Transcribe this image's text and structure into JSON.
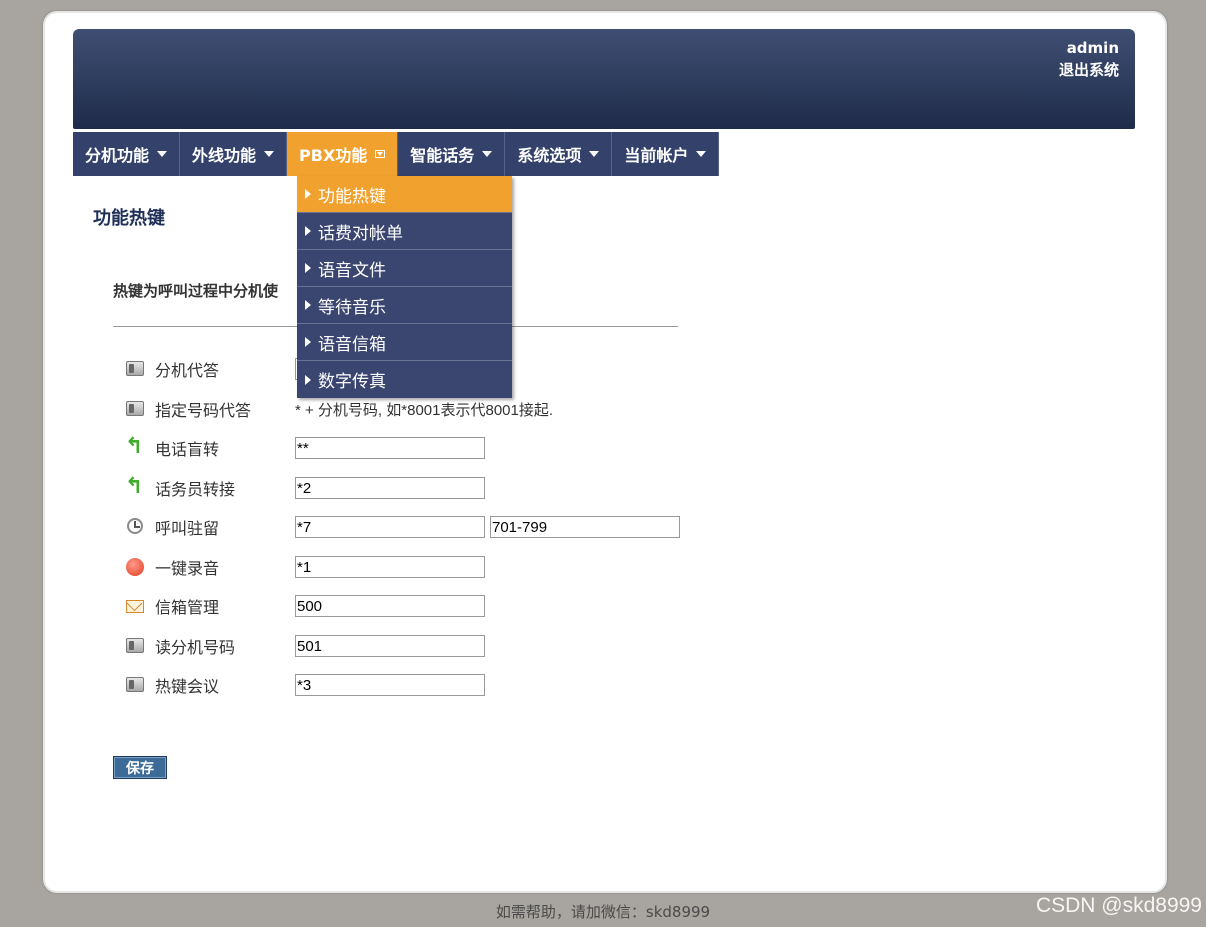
{
  "header": {
    "username": "admin",
    "logout": "退出系统"
  },
  "nav": [
    {
      "label": "分机功能"
    },
    {
      "label": "外线功能"
    },
    {
      "label": "PBX功能"
    },
    {
      "label": "智能话务"
    },
    {
      "label": "系统选项"
    },
    {
      "label": "当前帐户"
    }
  ],
  "dropdown": [
    {
      "label": "功能热键"
    },
    {
      "label": "话费对帐单"
    },
    {
      "label": "语音文件"
    },
    {
      "label": "等待音乐"
    },
    {
      "label": "语音信箱"
    },
    {
      "label": "数字传真"
    }
  ],
  "page": {
    "title": "功能热键",
    "description": "热键为呼叫过程中分机使"
  },
  "hotkeys": [
    {
      "label": "分机代答",
      "icon": "phone-icon",
      "value": ""
    },
    {
      "label": "指定号码代答",
      "icon": "phone-icon",
      "note": "* + 分机号码, 如*8001表示代8001接起."
    },
    {
      "label": "电话盲转",
      "icon": "transfer-icon",
      "value": "**"
    },
    {
      "label": "话务员转接",
      "icon": "transfer-icon",
      "value": "*2"
    },
    {
      "label": "呼叫驻留",
      "icon": "clock-icon",
      "value": "*7",
      "value2": "701-799"
    },
    {
      "label": "一键录音",
      "icon": "record-icon",
      "value": "*1"
    },
    {
      "label": "信箱管理",
      "icon": "mail-icon",
      "value": "500"
    },
    {
      "label": "读分机号码",
      "icon": "phone-icon",
      "value": "501"
    },
    {
      "label": "热键会议",
      "icon": "phone-icon",
      "value": "*3"
    }
  ],
  "save_label": "保存",
  "footer": "如需帮助，请加微信：skd8999",
  "watermark": "CSDN @skd8999",
  "colors": {
    "nav_bg": "#33416b",
    "active": "#f1a12e",
    "title": "#1f2f57"
  }
}
